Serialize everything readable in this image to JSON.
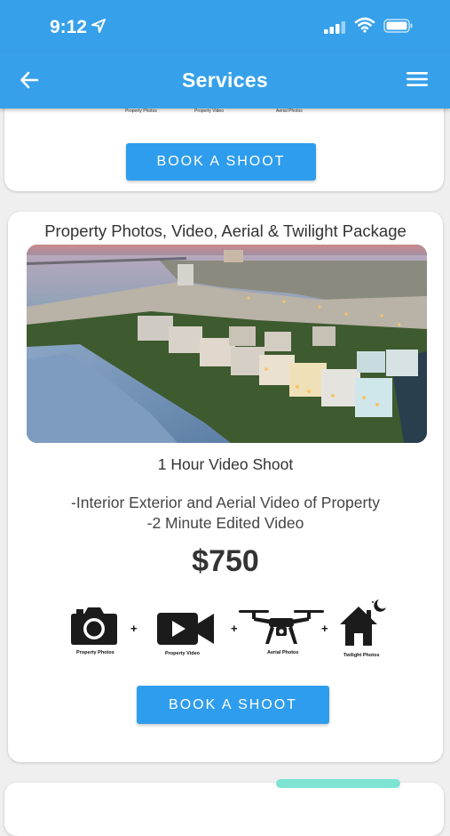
{
  "status_bar": {
    "time": "9:12"
  },
  "app_bar": {
    "title": "Services"
  },
  "card_prev": {
    "icon_labels": [
      "Property Photos",
      "Property Video",
      "Aerial Photos"
    ],
    "book_label": "BOOK A SHOOT"
  },
  "package": {
    "title": "Property Photos, Video, Aerial & Twilight Package",
    "subtitle": "1 Hour Video Shoot",
    "description": [
      "-Interior Exterior and Aerial Video of Property",
      "-2 Minute Edited Video"
    ],
    "price": "$750",
    "icons": [
      {
        "icon": "camera-icon",
        "label": "Property Photos"
      },
      {
        "icon": "video-camera-icon",
        "label": "Property Video"
      },
      {
        "icon": "drone-icon",
        "label": "Aerial Photos"
      },
      {
        "icon": "house-moon-icon",
        "label": "Twilight Photos"
      }
    ],
    "plus": "+",
    "book_label": "BOOK A SHOOT"
  },
  "colors": {
    "primary": "#36a0ea",
    "button": "#2f9ded",
    "card": "#ffffff",
    "background": "#efefef"
  }
}
